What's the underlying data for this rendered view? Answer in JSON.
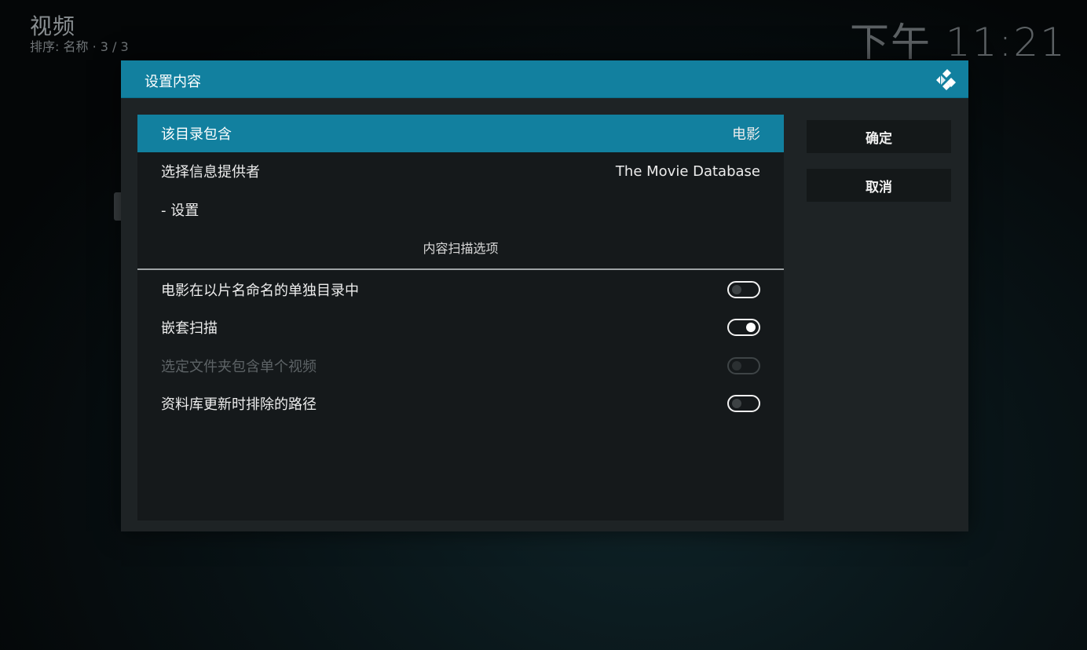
{
  "header": {
    "title": "视频",
    "subtitle": "排序: 名称 · 3 / 3",
    "clock": "下午 11:21"
  },
  "dialog": {
    "title": "设置内容",
    "logo_icon": "kodi-logo-icon",
    "rows": [
      {
        "label": "该目录包含",
        "value": "电影"
      },
      {
        "label": "选择信息提供者",
        "value": "The Movie Database"
      },
      {
        "label": "- 设置",
        "value": ""
      }
    ],
    "section_label": "内容扫描选项",
    "toggles": [
      {
        "label": "电影在以片名命名的单独目录中",
        "state": "off",
        "enabled": true
      },
      {
        "label": "嵌套扫描",
        "state": "on",
        "enabled": true
      },
      {
        "label": "选定文件夹包含单个视频",
        "state": "off",
        "enabled": false
      },
      {
        "label": "资料库更新时排除的路径",
        "state": "off",
        "enabled": true
      }
    ],
    "buttons": {
      "ok": "确定",
      "cancel": "取消"
    }
  },
  "colors": {
    "accent": "#12809f",
    "dialog_bg": "#1e2325",
    "panel_bg": "#15191b"
  }
}
